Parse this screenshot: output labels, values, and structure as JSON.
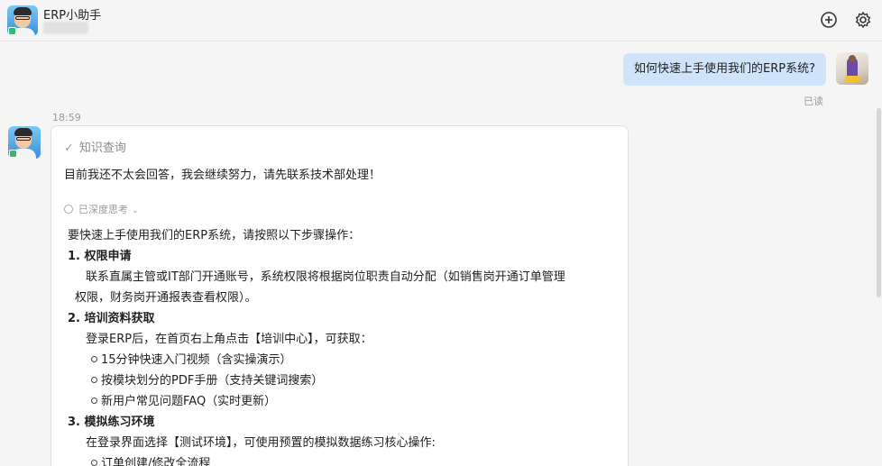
{
  "header": {
    "bot_name": "ERP小助手",
    "add_icon": "plus-circle-icon",
    "settings_icon": "gear-icon"
  },
  "user_message": {
    "text": "如何快速上手使用我们的ERP系统?",
    "status": "已读"
  },
  "bot_message": {
    "timestamp": "18:59",
    "knowledge_label": "知识查询",
    "answer": "目前我还不太会回答，我会继续努力，请先联系技术部处理！",
    "thinking_label": "已深度思考",
    "intro": "要快速上手使用我们的ERP系统，请按照以下步骤操作：",
    "steps": [
      {
        "title": "1. 权限申请",
        "body": "联系直属主管或IT部门开通账号，系统权限将根据岗位职责自动分配（如销售岗开通订单管理",
        "body2": "权限，财务岗开通报表查看权限）。"
      },
      {
        "title": "2. 培训资料获取",
        "body": "登录ERP后，在首页右上角点击【培训中心】，可获取：",
        "bullets": [
          "15分钟快速入门视频（含实操演示）",
          "按模块划分的PDF手册（支持关键词搜索）",
          "新用户常见问题FAQ（实时更新）"
        ]
      },
      {
        "title": "3. 模拟练习环境",
        "body": "在登录界面选择【测试环境】，可使用预置的模拟数据练习核心操作:",
        "bullets": [
          "订单创建/修改全流程"
        ]
      }
    ]
  }
}
